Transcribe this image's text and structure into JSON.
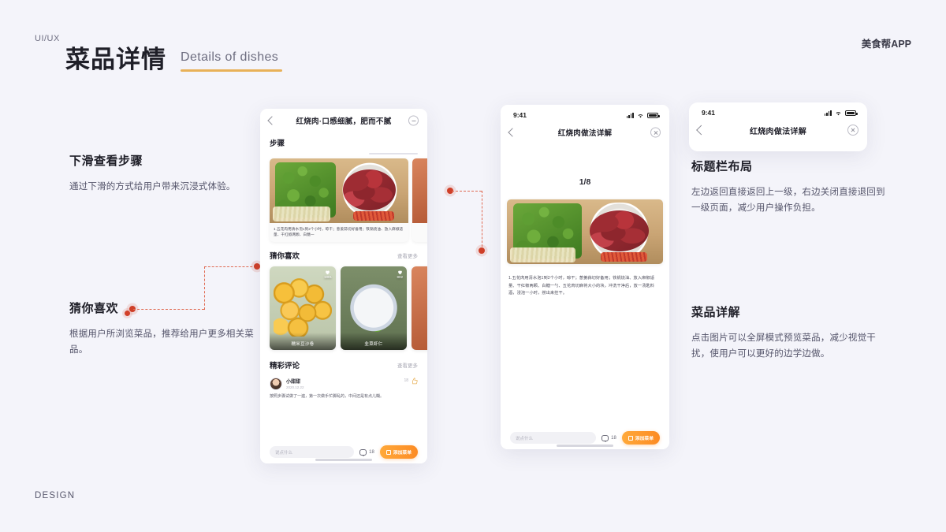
{
  "header": {
    "kicker": "UI/UX",
    "title_cn": "菜品详情",
    "title_en": "Details of dishes",
    "brand": "美食帮APP",
    "footer": "DESIGN",
    "accent_underline": "#e8b158",
    "connector_color": "#cf3f28",
    "background": "#f4f4fa"
  },
  "annotations": [
    {
      "id": "scroll-steps",
      "title": "下滑查看步骤",
      "body": "通过下滑的方式给用户带来沉浸式体验。",
      "has_dot": false
    },
    {
      "id": "guess-you-like",
      "title": "猜你喜欢",
      "body": "根据用户所浏览菜品，推荐给用户更多相关菜品。",
      "has_dot": true
    },
    {
      "id": "title-bar-layout",
      "title": "标题栏布局",
      "body": "左边返回直接返回上一级，右边关闭直接退回到一级页面，减少用户操作负担。",
      "has_dot": false
    },
    {
      "id": "dish-detail-explain",
      "title": "菜品详解",
      "body": "点击图片可以全屏模式预览菜品，减少视觉干扰，使用户可以更好的边学边做。",
      "has_dot": false
    }
  ],
  "phone_a": {
    "nav": {
      "title": "红烧肉·口感细腻，肥而不腻",
      "back_icon": "chevron-left-icon",
      "right_icon": "refresh-icon"
    },
    "steps_section": {
      "title": "步骤",
      "step_text": "1.五花肉用清水泡1到2个小时，晾干；葱姜蒜切好备用；铁锅烧油、放入麻椒适量、干红椒两颗、白糖一"
    },
    "likes_section": {
      "title": "猜你喜欢",
      "more": "查看更多",
      "cards": [
        {
          "label": "糯米豆沙卷",
          "likes": "1881",
          "photo": "rolls"
        },
        {
          "label": "韭菜虾仁",
          "likes": "802",
          "photo": "shrimp"
        },
        {
          "label": "",
          "likes": "",
          "photo": "red"
        }
      ]
    },
    "comments_section": {
      "title": "精彩评论",
      "more": "查看更多",
      "comment": {
        "author": "小甜甜",
        "date": "2020.12.22",
        "likes": "18",
        "text": "按照步骤试做了一遍，第一次做手忙脚乱的，中间还是有点儿糊。"
      }
    },
    "bottom_bar": {
      "input_placeholder": "说点什么",
      "comment_count": "18",
      "add_button": "添加菜单"
    }
  },
  "phone_b": {
    "status": {
      "time": "9:41",
      "signal": "signal-icon",
      "wifi": "wifi-icon",
      "battery": "battery-icon"
    },
    "nav": {
      "title": "红烧肉做法详解",
      "back_icon": "chevron-left-icon",
      "close_icon": "close-circle-icon"
    },
    "pager": "1/8",
    "recipe_text": "1.五花肉用清水泡1到2个小时，晾干；葱姜蒜切好备用；铁锅烧油、放入麻椒适量、干红椒两颗、白糖一勺、五花肉切麻将大小的块，冲洗干净后，放一汤匙料酒，浸泡一小时，捞出来控干。",
    "bottom_bar": {
      "input_placeholder": "说点什么",
      "comment_count": "18",
      "add_button": "添加菜单"
    }
  },
  "phone_c": {
    "status": {
      "time": "9:41"
    },
    "nav": {
      "title": "红烧肉做法详解",
      "back_icon": "chevron-left-icon",
      "close_icon": "close-circle-icon"
    }
  }
}
